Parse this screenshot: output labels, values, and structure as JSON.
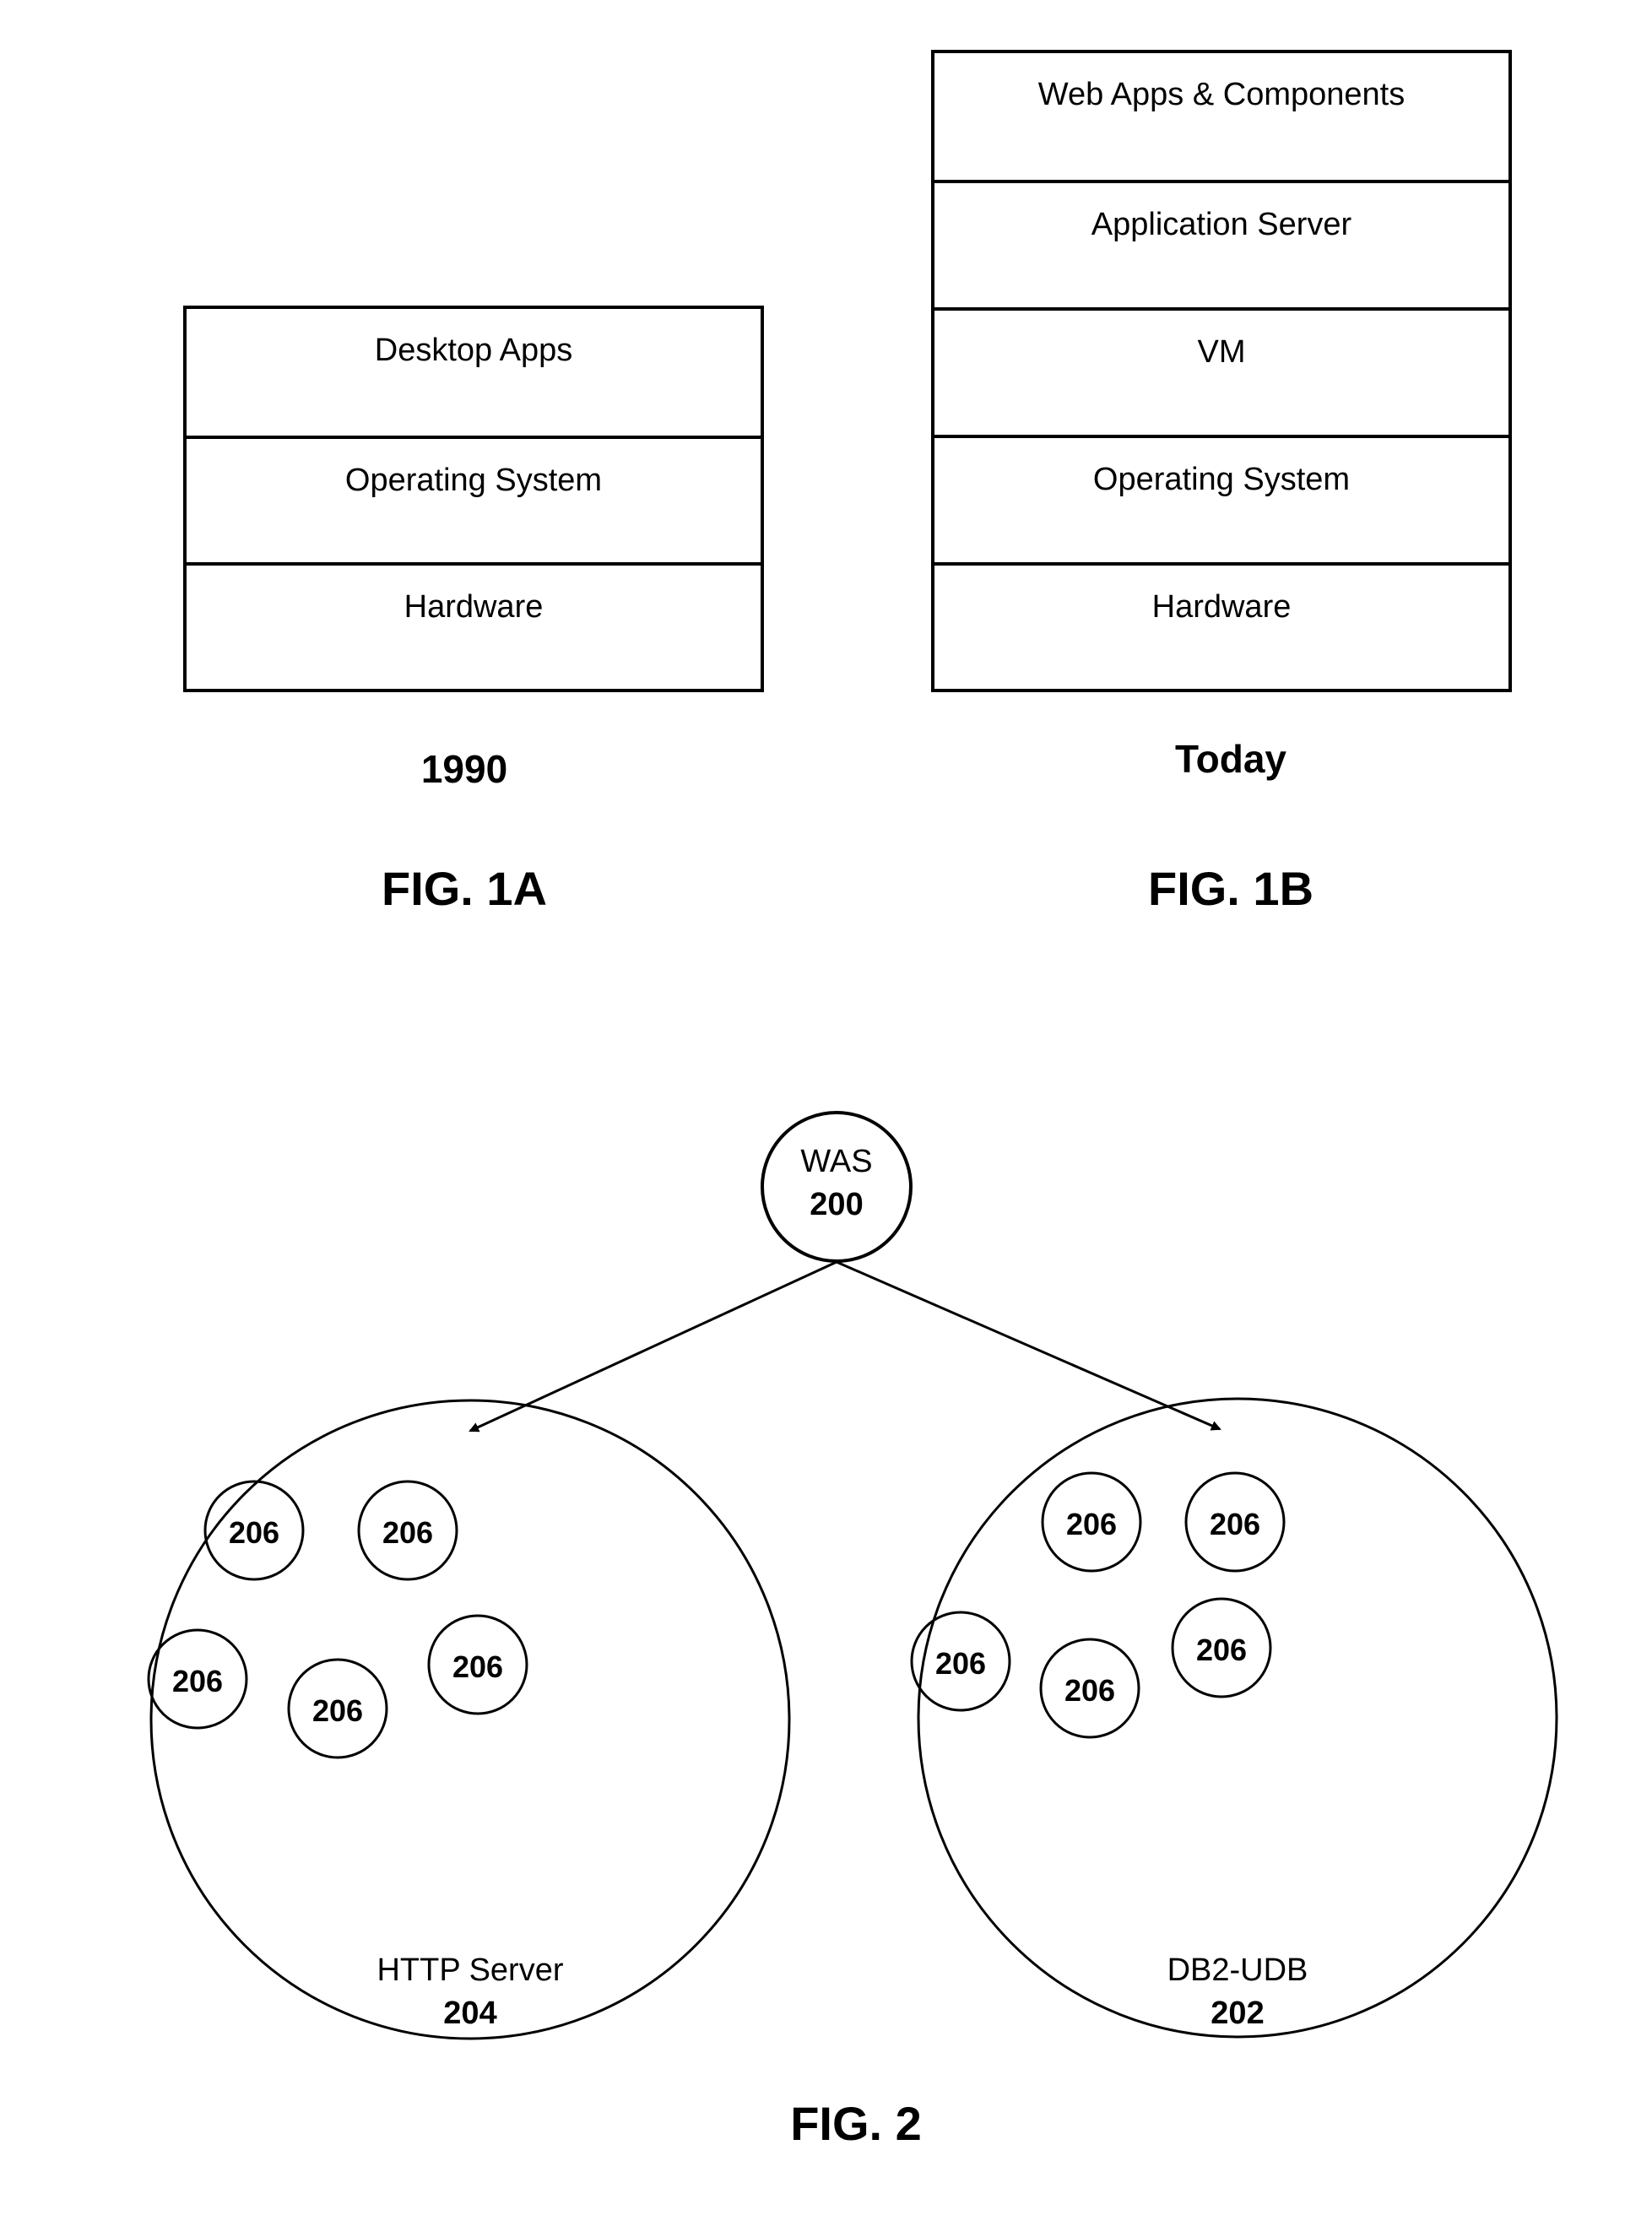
{
  "fig1a": {
    "layers": [
      "Desktop Apps",
      "Operating System",
      "Hardware"
    ],
    "era_label": "1990",
    "figure_label": "FIG. 1A"
  },
  "fig1b": {
    "layers": [
      "Web Apps & Components",
      "Application Server",
      "VM",
      "Operating System",
      "Hardware"
    ],
    "era_label": "Today",
    "figure_label": "FIG. 1B"
  },
  "fig2": {
    "root": {
      "name": "WAS",
      "ref": "200"
    },
    "children": [
      {
        "name": "HTTP Server",
        "ref": "204",
        "members": [
          "206",
          "206",
          "206",
          "206",
          "206"
        ]
      },
      {
        "name": "DB2-UDB",
        "ref": "202",
        "members": [
          "206",
          "206",
          "206",
          "206",
          "206"
        ]
      }
    ],
    "figure_label": "FIG. 2"
  }
}
